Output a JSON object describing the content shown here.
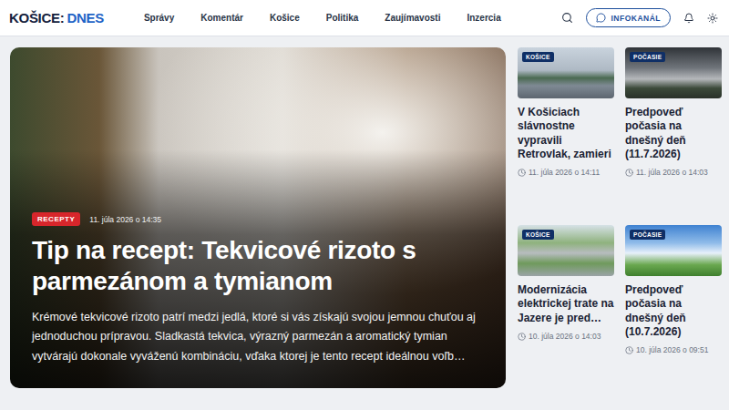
{
  "header": {
    "logo": {
      "primary": "KOŠICE:",
      "accent": "DNES"
    },
    "nav": [
      "Správy",
      "Komentár",
      "Košice",
      "Politika",
      "Zaujímavosti",
      "Inzercia"
    ],
    "infokanal_button": "INFOKANÁL"
  },
  "hero": {
    "category": "RECEPTY",
    "date": "11. júla 2026 o 14:35",
    "title": "Tip na recept: Tekvicové rizoto s parmezánom a tymianom",
    "excerpt": "Krémové tekvicové rizoto patrí medzi jedlá, ktoré si vás získajú svojou jemnou chuťou aj jednoduchou prípravou. Sladkastá tekvica, výrazný parmezán a aromatický tymian vytvárajú dokonale vyváženú kombináciu, vďaka ktorej je tento recept ideálnou voľb…"
  },
  "cards": [
    {
      "category": "KOŠICE",
      "title": "V Košiciach slávnostne vypravili Retrovlak, zamieri",
      "date": "11. júla 2026 o 14:11"
    },
    {
      "category": "POČASIE",
      "title": "Predpoveď počasia na dnešný deň (11.7.2026)",
      "date": "11. júla 2026 o 14:03"
    },
    {
      "category": "KOŠICE",
      "title": "Modernizácia elektrickej trate na Jazere je pred…",
      "date": "10. júla 2026 o 14:03"
    },
    {
      "category": "POČASIE",
      "title": "Predpoveď počasia na dnešný deň (10.7.2026)",
      "date": "10. júla 2026 o 09:51"
    }
  ]
}
